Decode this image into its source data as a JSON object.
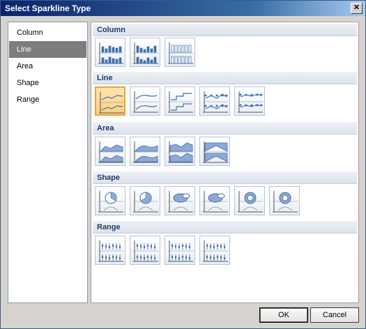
{
  "window": {
    "title": "Select Sparkline Type",
    "close_label": "✕"
  },
  "sidebar": {
    "items": [
      {
        "label": "Column",
        "selected": false
      },
      {
        "label": "Line",
        "selected": true
      },
      {
        "label": "Area",
        "selected": false
      },
      {
        "label": "Shape",
        "selected": false
      },
      {
        "label": "Range",
        "selected": false
      }
    ]
  },
  "gallery": {
    "sections": [
      {
        "title": "Column",
        "tile_count": 3,
        "icon": "column-sparkline-icon"
      },
      {
        "title": "Line",
        "tile_count": 5,
        "icon": "line-sparkline-icon",
        "selected_index": 0
      },
      {
        "title": "Area",
        "tile_count": 4,
        "icon": "area-sparkline-icon"
      },
      {
        "title": "Shape",
        "tile_count": 6,
        "icon": "pie-sparkline-icon"
      },
      {
        "title": "Range",
        "tile_count": 4,
        "icon": "range-sparkline-icon"
      }
    ]
  },
  "buttons": {
    "ok": "OK",
    "cancel": "Cancel"
  },
  "colors": {
    "accent_selected": "#f0a040",
    "series": "#3f6fb0",
    "fill": "#8ea9d6"
  }
}
